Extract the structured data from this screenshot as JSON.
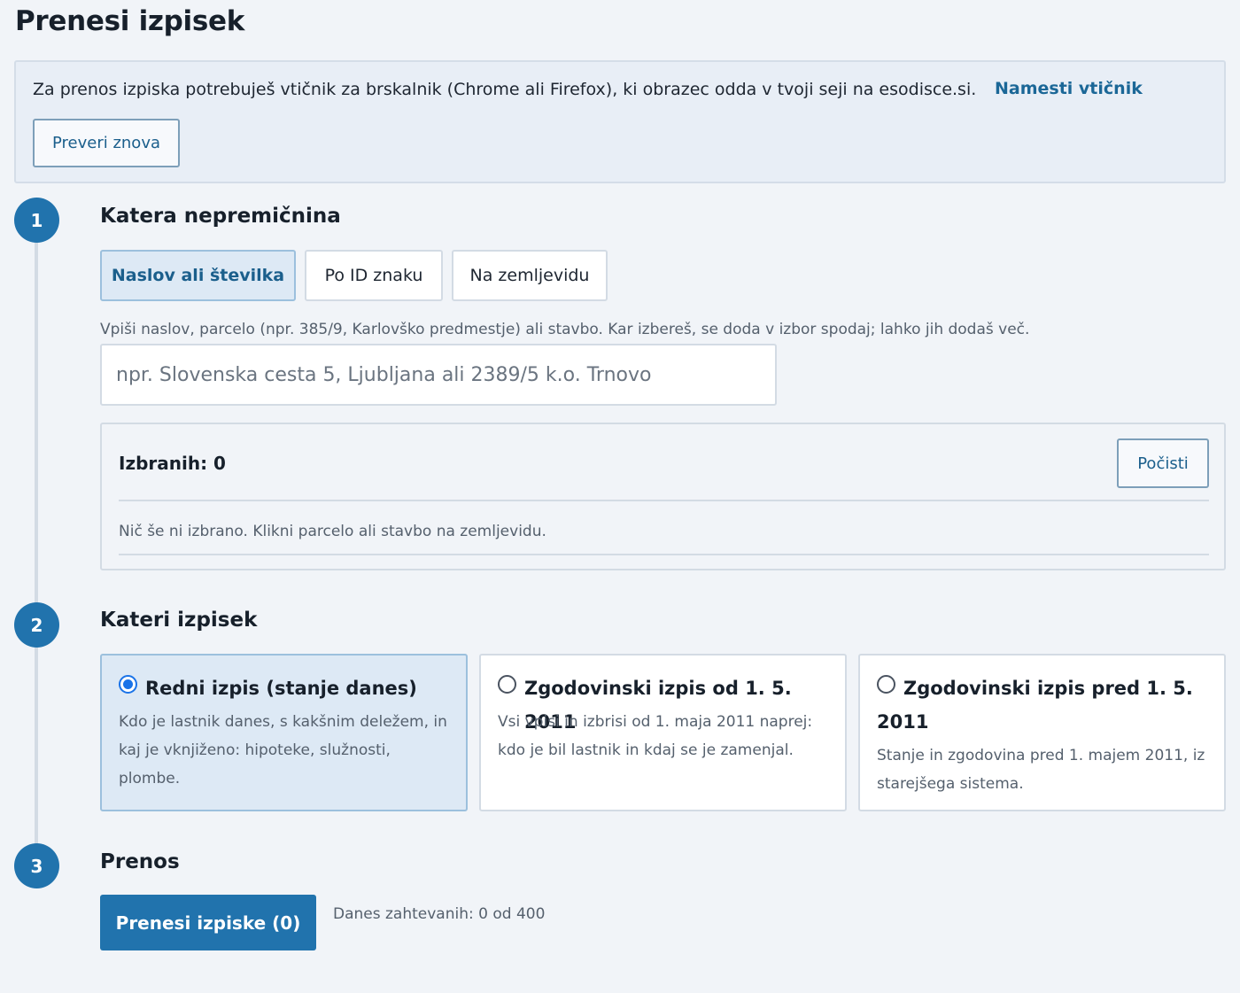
{
  "page": {
    "title": "Prenesi izpisek"
  },
  "notice": {
    "text": "Za prenos izpiska potrebuješ vtičnik za brskalnik (Chrome ali Firefox), ki obrazec odda v tvoji seji na esodisce.si.",
    "install_link": "Namesti vtičnik",
    "recheck_button": "Preveri znova"
  },
  "steps": [
    {
      "number": "1",
      "title": "Katera nepremičnina"
    },
    {
      "number": "2",
      "title": "Kateri izpisek"
    },
    {
      "number": "3",
      "title": "Prenos"
    }
  ],
  "search": {
    "tabs": [
      {
        "label": "Naslov ali številka",
        "active": true
      },
      {
        "label": "Po ID znaku",
        "active": false
      },
      {
        "label": "Na zemljevidu",
        "active": false
      }
    ],
    "hint": "Vpiši naslov, parcelo (npr. 385/9, Karlovško predmestje) ali stavbo. Kar izbereš, se doda v izbor spodaj; lahko jih dodaš več.",
    "placeholder": "npr. Slovenska cesta 5, Ljubljana ali 2389/5 k.o. Trnovo",
    "value": ""
  },
  "selection": {
    "count_label": "Izbranih: 0",
    "clear_button": "Počisti",
    "empty_text": "Nič še ni izbrano. Klikni parcelo ali stavbo na zemljevidu."
  },
  "options": [
    {
      "title": "Redni izpis (stanje danes)",
      "description": "Kdo je lastnik danes, s kakšnim deležem, in kaj je vknjiženo: hipoteke, služnosti, plombe.",
      "selected": true
    },
    {
      "title": "Zgodovinski izpis od 1. 5. 2011",
      "description": "Vsi vpisi in izbrisi od 1. maja 2011 naprej: kdo je bil lastnik in kdaj se je zamenjal.",
      "selected": false
    },
    {
      "title": "Zgodovinski izpis pred 1. 5. 2011",
      "description": "Stanje in zgodovina pred 1. majem 2011, iz starejšega sistema.",
      "selected": false
    }
  ],
  "download": {
    "button": "Prenesi izpiske (0)",
    "quota": "Danes zahtevanih: 0 od 400"
  },
  "colors": {
    "accent": "#2173ad",
    "link": "#1b6797",
    "background": "#f1f4f8",
    "active_bg": "#dde9f5",
    "radio": "#1a73e8"
  }
}
